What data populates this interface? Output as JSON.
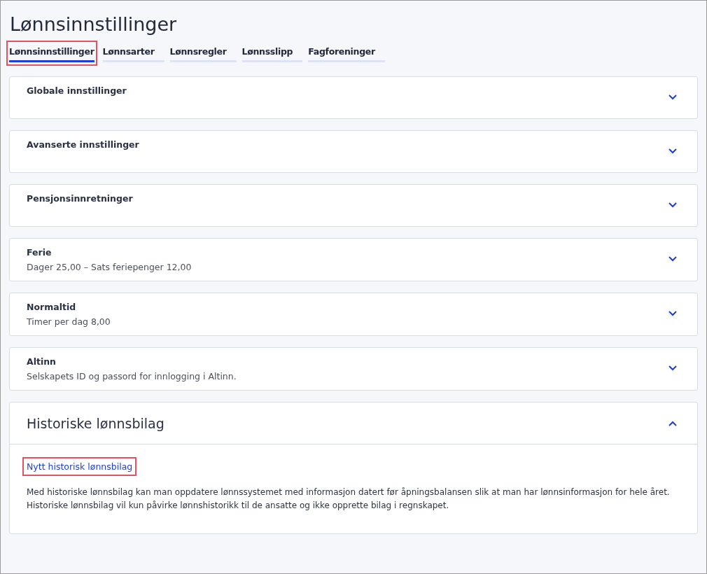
{
  "page": {
    "title": "Lønnsinnstillinger"
  },
  "tabs": [
    {
      "label": "Lønnsinnstillinger",
      "selected": true,
      "highlighted": true
    },
    {
      "label": "Lønnsarter",
      "selected": false,
      "highlighted": false
    },
    {
      "label": "Lønnsregler",
      "selected": false,
      "highlighted": false
    },
    {
      "label": "Lønnsslipp",
      "selected": false,
      "highlighted": false
    },
    {
      "label": "Fagforeninger",
      "selected": false,
      "highlighted": false
    }
  ],
  "sections": [
    {
      "title": "Globale innstillinger",
      "expanded": false
    },
    {
      "title": "Avanserte innstillinger",
      "expanded": false
    },
    {
      "title": "Pensjonsinnretninger",
      "expanded": false
    },
    {
      "title": "Ferie",
      "summary": "Dager 25,00  –  Sats feriepenger 12,00",
      "expanded": false
    },
    {
      "title": "Normaltid",
      "summary": "Timer per dag 8,00",
      "expanded": false
    },
    {
      "title": "Altinn",
      "summary": "Selskapets ID og passord for innlogging i Altinn.",
      "expanded": false
    },
    {
      "title": "Historiske lønnsbilag",
      "expanded": true,
      "link": {
        "label": "Nytt historisk lønnsbilag",
        "highlighted": true
      },
      "description": "Med historiske lønnsbilag kan man oppdatere lønnssystemet med informasjon datert før åpningsbalansen slik at man har lønnsinformasjon for hele året. Historiske lønnsbilag vil kun påvirke lønnshistorikk til de ansatte og ikke opprette bilag i regnskapet."
    }
  ]
}
